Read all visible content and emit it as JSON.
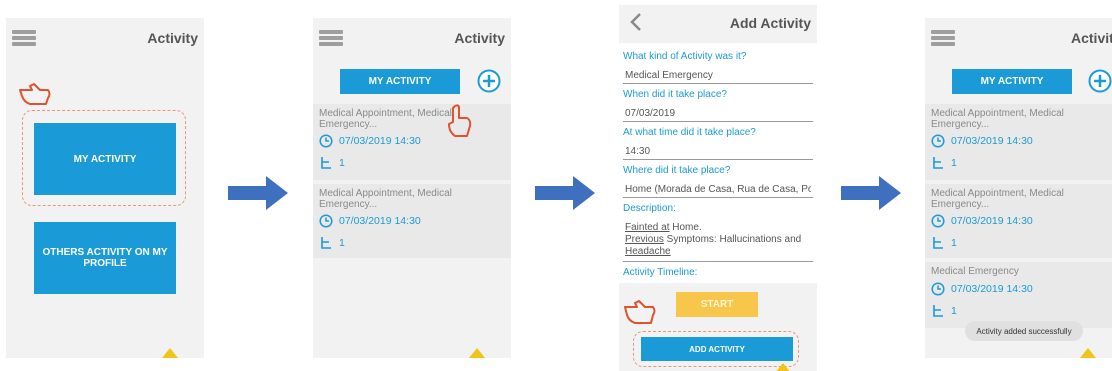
{
  "screen1": {
    "title": "Activity",
    "my_activity": "MY ACTIVITY",
    "others_activity": "OTHERS ACTIVITY ON MY PROFILE"
  },
  "screen2": {
    "title": "Activity",
    "my_activity": "MY ACTIVITY",
    "cards": [
      {
        "title": "Medical Appointment, Medical Emergency...",
        "date": "07/03/2019 14:30",
        "count": "1"
      },
      {
        "title": "Medical Appointment, Medical Emergency...",
        "date": "07/03/2019 14:30",
        "count": "1"
      }
    ]
  },
  "screen3": {
    "title": "Add Activity",
    "q_kind": "What kind of Activity was it?",
    "v_kind": "Medical Emergency",
    "q_when": "When did it take place?",
    "v_when": "07/03/2019",
    "q_time": "At what time did it take place?",
    "v_time": "14:30",
    "q_where": "Where did it take place?",
    "v_where": "Home (Morada de Casa, Rua de Casa, Por",
    "q_desc": "Description:",
    "v_desc_1a": "Fainted",
    "v_desc_1b": " at",
    "v_desc_1c": " Home.",
    "v_desc_2a": "Previous",
    "v_desc_2b": " Symptoms: Hallucinations and",
    "v_desc_3": "Headache",
    "q_timeline": "Activity Timeline:",
    "start": "START",
    "add_activity": "ADD ACTIVITY"
  },
  "screen4": {
    "title": "Activity",
    "my_activity": "MY ACTIVITY",
    "cards": [
      {
        "title": "Medical Appointment, Medical Emergency...",
        "date": "07/03/2019 14:30",
        "count": "1"
      },
      {
        "title": "Medical Appointment, Medical Emergency...",
        "date": "07/03/2019 14:30",
        "count": "1"
      },
      {
        "title": "Medical Emergency",
        "date": "07/03/2019 14:30",
        "count": "1"
      }
    ],
    "toast": "Activity added successfully"
  },
  "colors": {
    "accent": "#1a9bd7",
    "warning": "#f0c419",
    "start": "#f7c64a",
    "arrow": "#3f6fbf"
  }
}
